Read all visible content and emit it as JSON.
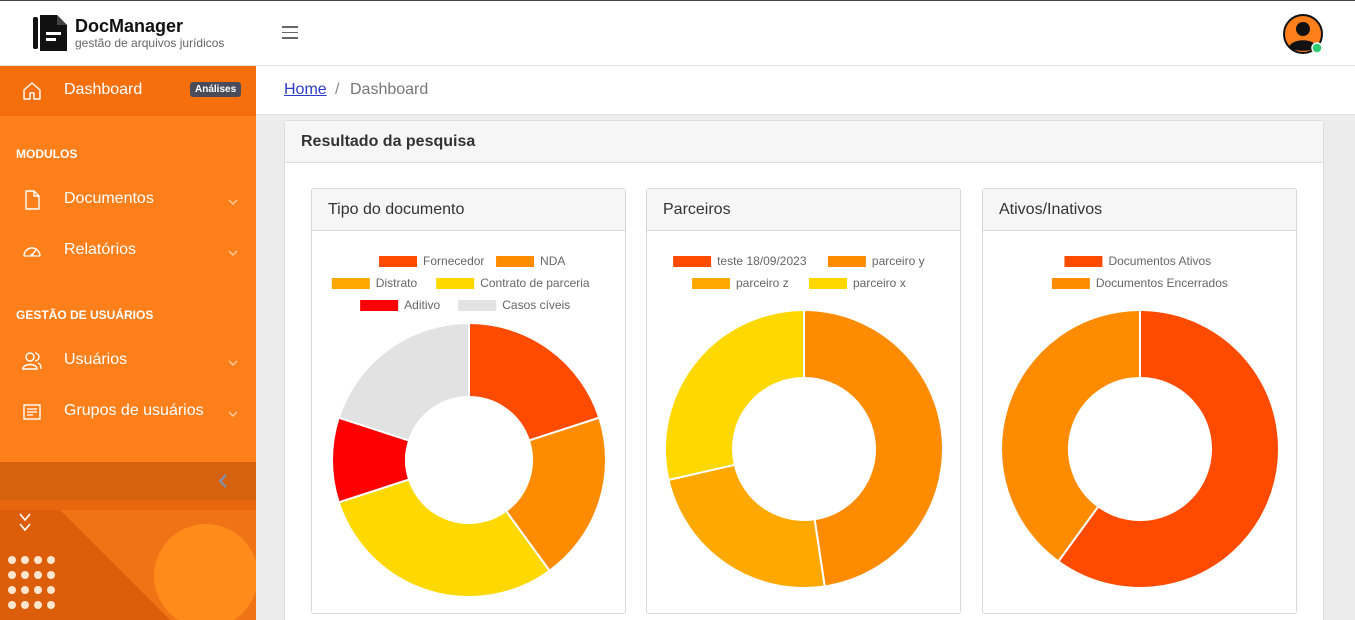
{
  "app": {
    "title": "DocManager",
    "subtitle": "gestão de arquivos jurídicos"
  },
  "sidebar": {
    "dashboard": {
      "label": "Dashboard",
      "badge": "Análises"
    },
    "section_modules": "MODULOS",
    "documents": "Documentos",
    "reports": "Relatórios",
    "section_users": "GESTÃO DE USUÁRIOS",
    "users": "Usuários",
    "user_groups": "Grupos de usuários"
  },
  "breadcrumb": {
    "home": "Home",
    "separator": "/",
    "current": "Dashboard"
  },
  "main": {
    "title": "Resultado da pesquisa"
  },
  "colors": {
    "brand": "#ff7f1a",
    "brand_dark": "#f56f0c",
    "red_orange": "#ff4b00",
    "orange": "#ff8c00",
    "amber": "#ffa800",
    "yellow": "#ffd800",
    "red": "#ff0000",
    "gray": "#e2e2e2",
    "online": "#2ecc71"
  },
  "chart_data": [
    {
      "type": "pie",
      "title": "Tipo do documento",
      "categories": [
        "Fornecedor",
        "NDA",
        "Distrato",
        "Contrato de parceria",
        "Aditivo",
        "Casos cíveis"
      ],
      "values": [
        1,
        1,
        0,
        1.5,
        0.5,
        1
      ],
      "colors": [
        "#ff4b00",
        "#ff8c00",
        "#ffa800",
        "#ffd800",
        "#ff0000",
        "#e2e2e2"
      ],
      "donut": true
    },
    {
      "type": "pie",
      "title": "Parceiros",
      "categories": [
        "teste 18/09/2023",
        "parceiro y",
        "parceiro z",
        "parceiro x"
      ],
      "values": [
        0,
        2,
        1,
        1.2
      ],
      "colors": [
        "#ff4b00",
        "#ff8c00",
        "#ffa800",
        "#ffd800"
      ],
      "donut": true
    },
    {
      "type": "pie",
      "title": "Ativos/Inativos",
      "categories": [
        "Documentos Ativos",
        "Documentos Encerrados"
      ],
      "values": [
        3,
        2
      ],
      "colors": [
        "#ff4b00",
        "#ff8c00"
      ],
      "donut": true
    }
  ]
}
